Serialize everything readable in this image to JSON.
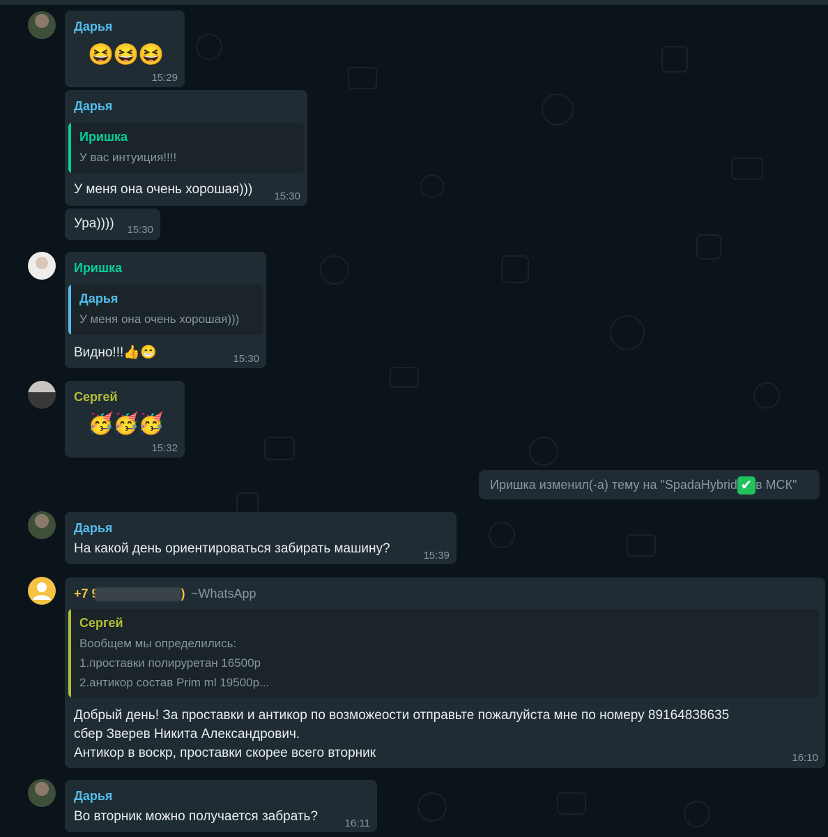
{
  "messages": [
    {
      "sender": "Дарья",
      "emoji": [
        "😆",
        "😆",
        "😆"
      ],
      "time": "15:29"
    },
    {
      "sender": "Дарья",
      "quote": {
        "sender": "Иришка",
        "text": "У вас интуиция!!!!"
      },
      "text": "У меня она очень хорошая)))",
      "time": "15:30"
    },
    {
      "text": "Ура))))",
      "time": "15:30"
    },
    {
      "sender": "Иришка",
      "quote": {
        "sender": "Дарья",
        "text": "У меня она очень хорошая)))"
      },
      "text": "Видно!!!",
      "text_emoji": [
        "👍",
        "😁"
      ],
      "time": "15:30"
    },
    {
      "sender": "Сергей",
      "emoji": [
        "🥳",
        "🥳",
        "🥳"
      ],
      "time": "15:32"
    },
    {
      "sender": "Дарья",
      "text": "На какой день ориентироваться забирать машину?",
      "time": "15:39"
    },
    {
      "sender": "+7 9",
      "sender_end": ")",
      "sender_suffix": "~WhatsApp",
      "quote": {
        "sender": "Сергей",
        "lines": [
          "Вообщем мы определились:",
          "1.проставки полируретан 16500р",
          "2.антикор состав Prim ml 19500р..."
        ]
      },
      "lines": [
        "Добрый день! За проставки и антикор по возможеости отправьте пожалуйста мне по номеру 89164838635",
        "сбер Зверев Никита Александрович.",
        "Антикор в воскр, проставки скорее всего вторник"
      ],
      "time": "16:10"
    },
    {
      "sender": "Дарья",
      "text": "Во вторник можно получается забрать?",
      "time": "16:11"
    }
  ],
  "system": {
    "before": "Иришка изменил(-а) тему на \"SpadaHybrid",
    "check": "✔",
    "after": "в МСК\""
  },
  "colors": {
    "background": "#0b141a",
    "bubble": "#202c33",
    "quote_bg": "#1a2429",
    "darya": "#53bdeb",
    "irishka": "#06cf9c",
    "sergey": "#b4be36",
    "unknown": "#f5c242"
  }
}
